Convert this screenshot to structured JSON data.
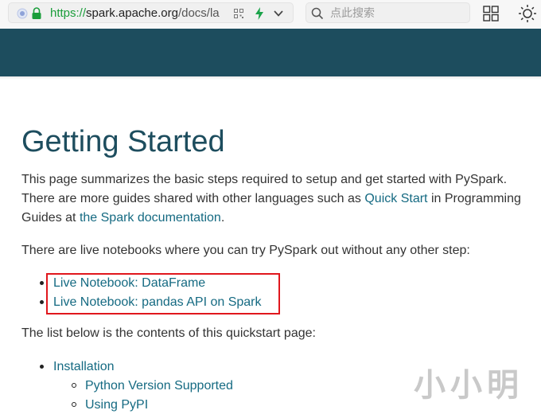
{
  "browser": {
    "url_scheme": "https://",
    "url_host": "spark.apache.org",
    "url_path": "/docs/la",
    "search_placeholder": "点此搜索"
  },
  "page": {
    "title": "Getting Started",
    "intro": {
      "text1": "This page summarizes the basic steps required to setup and get started with PySpark. There are more guides shared with other languages such as ",
      "link1": "Quick Start",
      "text2": " in Programming Guides at ",
      "link2": "the Spark documentation",
      "text3": "."
    },
    "notebooks_intro": "There are live notebooks where you can try PySpark out without any other step:",
    "notebooks": [
      "Live Notebook: DataFrame",
      "Live Notebook: pandas API on Spark"
    ],
    "contents_intro": "The list below is the contents of this quickstart page:",
    "contents": {
      "installation": "Installation",
      "sub": [
        "Python Version Supported",
        "Using PyPI"
      ]
    }
  },
  "watermark": "小小明",
  "colors": {
    "header": "#1d4d5e",
    "link": "#156a82",
    "highlight_box": "#e0171d"
  }
}
